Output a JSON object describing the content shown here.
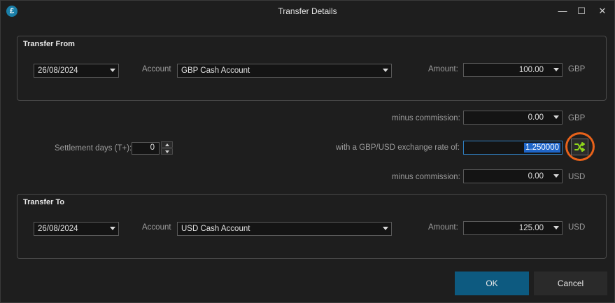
{
  "window": {
    "title": "Transfer Details",
    "app_icon_glyph": "£",
    "controls": {
      "minimize": "—",
      "maximize": "☐",
      "close": "✕"
    }
  },
  "transfer_from": {
    "heading": "Transfer From",
    "date": "26/08/2024",
    "account_label": "Account",
    "account": "GBP Cash Account",
    "amount_label": "Amount:",
    "amount": "100.00",
    "currency": "GBP"
  },
  "middle": {
    "commission1_label": "minus commission:",
    "commission1_value": "0.00",
    "commission1_currency": "GBP",
    "settlement_label": "Settlement days (T+):",
    "settlement_value": "0",
    "rate_label": "with a GBP/USD exchange rate of:",
    "rate_value": "1.250000",
    "commission2_label": "minus commission:",
    "commission2_value": "0.00",
    "commission2_currency": "USD"
  },
  "transfer_to": {
    "heading": "Transfer To",
    "date": "26/08/2024",
    "account_label": "Account",
    "account": "USD Cash Account",
    "amount_label": "Amount:",
    "amount": "125.00",
    "currency": "USD"
  },
  "buttons": {
    "ok": "OK",
    "cancel": "Cancel"
  },
  "colors": {
    "accent": "#0d5a80",
    "highlight_ring": "#e8621a",
    "swap_icon": "#8fd61c",
    "selection": "#1f66c9"
  },
  "icons": {
    "swap": "swap-arrows-icon"
  }
}
